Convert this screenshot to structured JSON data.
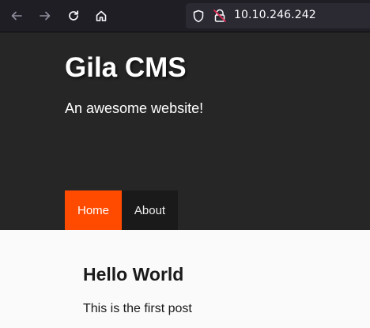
{
  "browser": {
    "url": "10.10.246.242",
    "icons": {
      "back": "back-arrow-icon",
      "forward": "forward-arrow-icon",
      "reload": "reload-icon",
      "home": "home-icon",
      "tracking": "shield-icon",
      "insecure": "insecure-lock-icon"
    }
  },
  "site": {
    "title": "Gila CMS",
    "tagline": "An awesome website!",
    "menu": [
      {
        "label": "Home",
        "active": true
      },
      {
        "label": "About",
        "active": false
      }
    ]
  },
  "post": {
    "title": "Hello World",
    "body": "This is the first post"
  },
  "colors": {
    "header_bg": "#262626",
    "accent": "#ff4b00",
    "toolbar_bg": "#1f1e25",
    "content_bg": "#fafafa"
  }
}
